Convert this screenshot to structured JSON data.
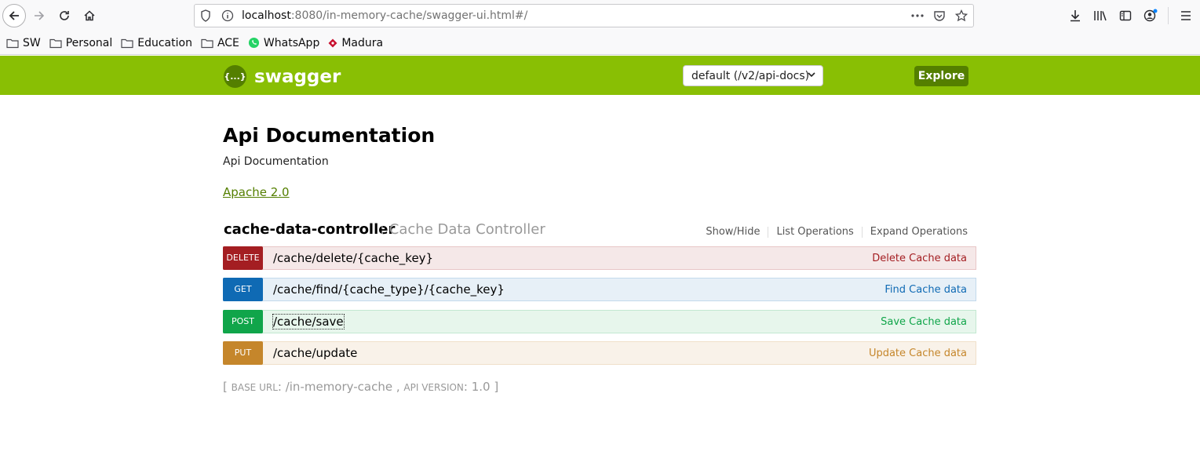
{
  "browser": {
    "url_host": "localhost",
    "url_rest": ":8080/in-memory-cache/swagger-ui.html#/",
    "bookmarks": [
      {
        "label": "SW",
        "icon": "folder-icon"
      },
      {
        "label": "Personal",
        "icon": "folder-icon"
      },
      {
        "label": "Education",
        "icon": "folder-icon"
      },
      {
        "label": "ACE",
        "icon": "folder-icon"
      },
      {
        "label": "WhatsApp",
        "icon": "whatsapp-icon"
      },
      {
        "label": "Madura",
        "icon": "madura-icon"
      }
    ]
  },
  "swagger": {
    "logo_text": "swagger",
    "logo_symbol": "{...}",
    "spec_select": "default (/v2/api-docs)",
    "explore_label": "Explore",
    "header_color": "#89bf04"
  },
  "info": {
    "title": "Api Documentation",
    "description": "Api Documentation",
    "license": "Apache 2.0"
  },
  "controller": {
    "name": "cache-data-controller",
    "separator_desc": ": Cache Data Controller",
    "actions": [
      "Show/Hide",
      "List Operations",
      "Expand Operations"
    ]
  },
  "operations": [
    {
      "method": "DELETE",
      "path": "/cache/delete/{cache_key}",
      "summary": "Delete Cache data",
      "color": "#a41e22"
    },
    {
      "method": "GET",
      "path": "/cache/find/{cache_type}/{cache_key}",
      "summary": "Find Cache data",
      "color": "#0f6ab4"
    },
    {
      "method": "POST",
      "path": "/cache/save",
      "summary": "Save Cache data",
      "color": "#10a54a"
    },
    {
      "method": "PUT",
      "path": "/cache/update",
      "summary": "Update Cache data",
      "color": "#c5862b"
    }
  ],
  "footer": {
    "open": "[ ",
    "base_url_label": "Base URL",
    "base_url": ": /in-memory-cache , ",
    "api_version_label": "Api Version",
    "api_version": ": 1.0 ",
    "close": "]"
  }
}
